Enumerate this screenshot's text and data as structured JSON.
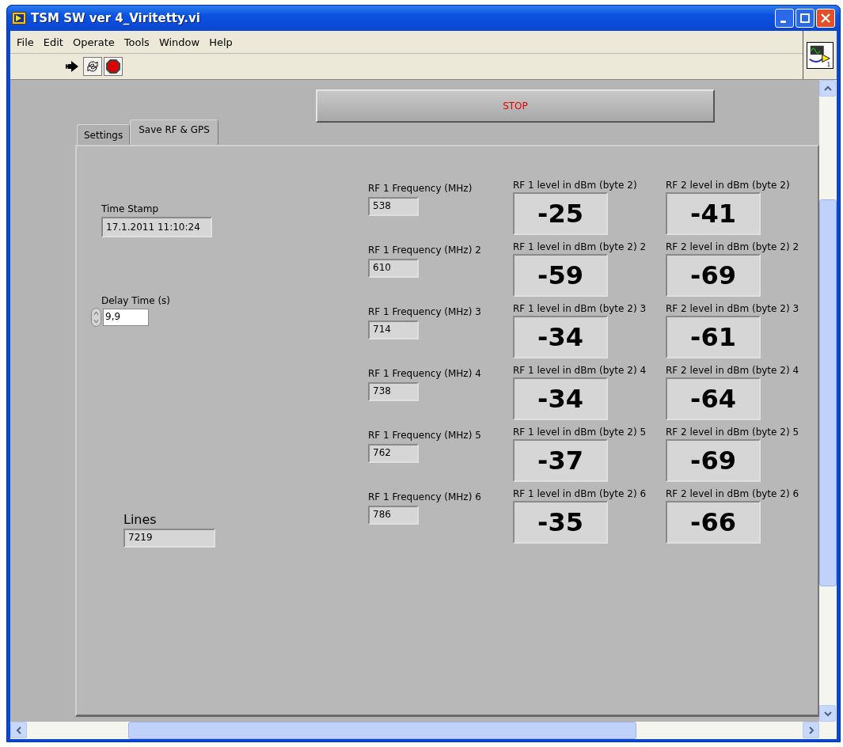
{
  "window": {
    "title": "TSM SW ver 4_Viritetty.vi"
  },
  "vi_icon": {
    "number": "1"
  },
  "menu": [
    "File",
    "Edit",
    "Operate",
    "Tools",
    "Window",
    "Help"
  ],
  "stop_button": {
    "label": "STOP"
  },
  "tabs": [
    {
      "label": "Settings",
      "selected": false
    },
    {
      "label": "Save RF & GPS",
      "selected": true
    }
  ],
  "time_stamp": {
    "label": "Time Stamp",
    "value": "17.1.2011 11:10:24"
  },
  "delay_time": {
    "label": "Delay Time (s)",
    "value": "9,9"
  },
  "lines": {
    "label": "Lines",
    "value": "7219"
  },
  "rows": [
    {
      "freq_label": "RF 1 Frequency (MHz)",
      "freq_value": "538",
      "rf1_label": "RF 1  level in dBm (byte 2)",
      "rf1_value": "-25",
      "rf2_label": "RF 2 level in dBm (byte 2)",
      "rf2_value": "-41"
    },
    {
      "freq_label": "RF 1 Frequency (MHz) 2",
      "freq_value": "610",
      "rf1_label": "RF 1  level in dBm (byte 2) 2",
      "rf1_value": "-59",
      "rf2_label": "RF 2 level in dBm (byte 2) 2",
      "rf2_value": "-69"
    },
    {
      "freq_label": "RF 1 Frequency (MHz) 3",
      "freq_value": "714",
      "rf1_label": "RF 1  level in dBm (byte 2) 3",
      "rf1_value": "-34",
      "rf2_label": "RF 2 level in dBm (byte 2) 3",
      "rf2_value": "-61"
    },
    {
      "freq_label": "RF 1 Frequency (MHz) 4",
      "freq_value": "738",
      "rf1_label": "RF 1  level in dBm (byte 2) 4",
      "rf1_value": "-34",
      "rf2_label": "RF 2 level in dBm (byte 2) 4",
      "rf2_value": "-64"
    },
    {
      "freq_label": "RF 1 Frequency (MHz) 5",
      "freq_value": "762",
      "rf1_label": "RF 1  level in dBm (byte 2) 5",
      "rf1_value": "-37",
      "rf2_label": "RF 2 level in dBm (byte 2) 5",
      "rf2_value": "-69"
    },
    {
      "freq_label": "RF 1 Frequency (MHz) 6",
      "freq_value": "786",
      "rf1_label": "RF 1  level in dBm (byte 2) 6",
      "rf1_value": "-35",
      "rf2_label": "RF 2 level in dBm (byte 2) 6",
      "rf2_value": "-66"
    }
  ]
}
